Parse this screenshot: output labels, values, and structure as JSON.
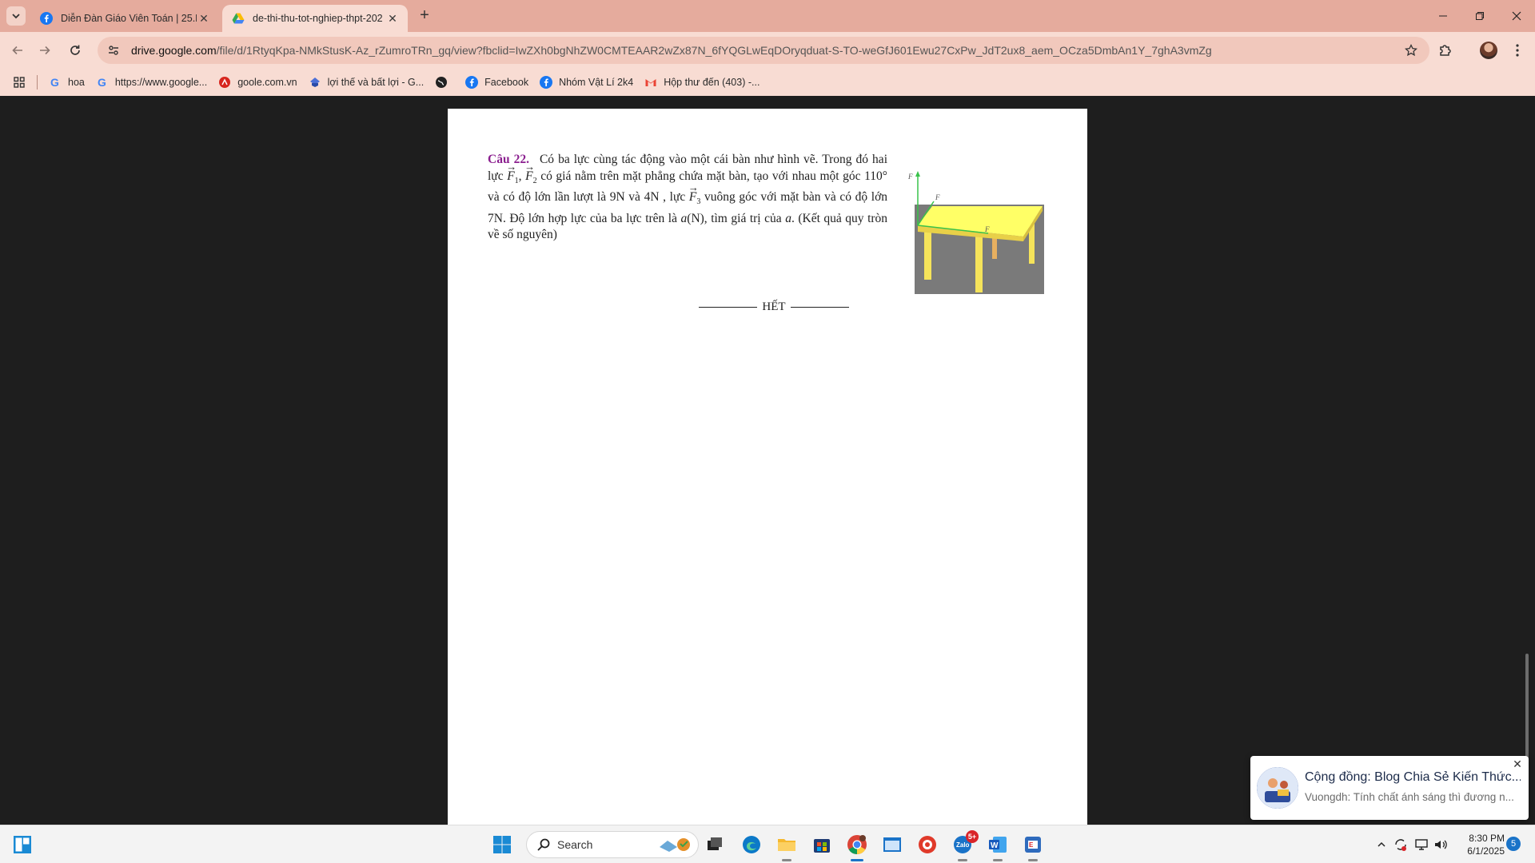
{
  "browser": {
    "tabs": [
      {
        "title": "Diễn Đàn Giáo Viên Toán | 25.D",
        "favicon": "facebook-icon",
        "active": false
      },
      {
        "title": "de-thi-thu-tot-nghiep-thpt-202",
        "favicon": "google-drive-icon",
        "active": true
      }
    ],
    "address_bar": {
      "host": "drive.google.com",
      "path": "/file/d/1RtyqKpa-NMkStusK-Az_rZumroTRn_gq/view?fbclid=IwZXh0bgNhZW0CMTEAAR2wZx87N_6fYQGLwEqDOryqduat-S-TO-weGfJ601Ewu27CxPw_JdT2ux8_aem_OCza5DmbAn1Y_7ghA3vmZg"
    },
    "bookmarks": [
      {
        "label": "hoa",
        "icon": "google-icon"
      },
      {
        "label": "https://www.google...",
        "icon": "google-icon"
      },
      {
        "label": "goole.com.vn",
        "icon": "adobe-icon"
      },
      {
        "label": "lợi thế và bất lợi - G...",
        "icon": "bookmark-icon"
      },
      {
        "label": "",
        "icon": "globe-icon"
      },
      {
        "label": "Facebook",
        "icon": "facebook-icon"
      },
      {
        "label": "Nhóm Vật Lí 2k4",
        "icon": "facebook-icon"
      },
      {
        "label": "Hộp thư đến (403) -...",
        "icon": "gmail-icon"
      }
    ]
  },
  "document": {
    "question_label": "Câu 22.",
    "text": {
      "p1": "Có ba lực cùng tác động vào một cái bàn như hình vẽ. Trong đó hai lực",
      "p2": "có giá nằm trên mặt phẳng chứa mặt bàn, tạo với nhau một góc 110° và có độ lớn lần lượt là 9N và 4N , lực",
      "p3": "vuông góc với mặt bàn và có độ lớn 7N. Độ lớn hợp lực của ba lực trên là",
      "p4": "(N), tìm giá trị của",
      "p5": ". (Kết quả quy tròn về số nguyên)",
      "var_a": "a",
      "vec_letter": "F",
      "sub1": "1",
      "sub2": "2",
      "sub3": "3"
    },
    "end_marker": "HẾT"
  },
  "notification": {
    "title": "Cộng đồng: Blog Chia Sẻ Kiến Thức...",
    "body": "Vuongdh: Tính chất ánh sáng thì đương n..."
  },
  "taskbar": {
    "search_placeholder": "Search",
    "zalo_badge": "5+",
    "clock_time": "8:30 PM",
    "clock_date": "6/1/2025",
    "notification_count": "5"
  },
  "colors": {
    "chrome_frame": "#e5ab9d",
    "chrome_toolbar": "#f8dcd3",
    "question_label": "#8b1f8f",
    "table_top": "#ffff66",
    "figure_bg": "#7a7a7a"
  }
}
